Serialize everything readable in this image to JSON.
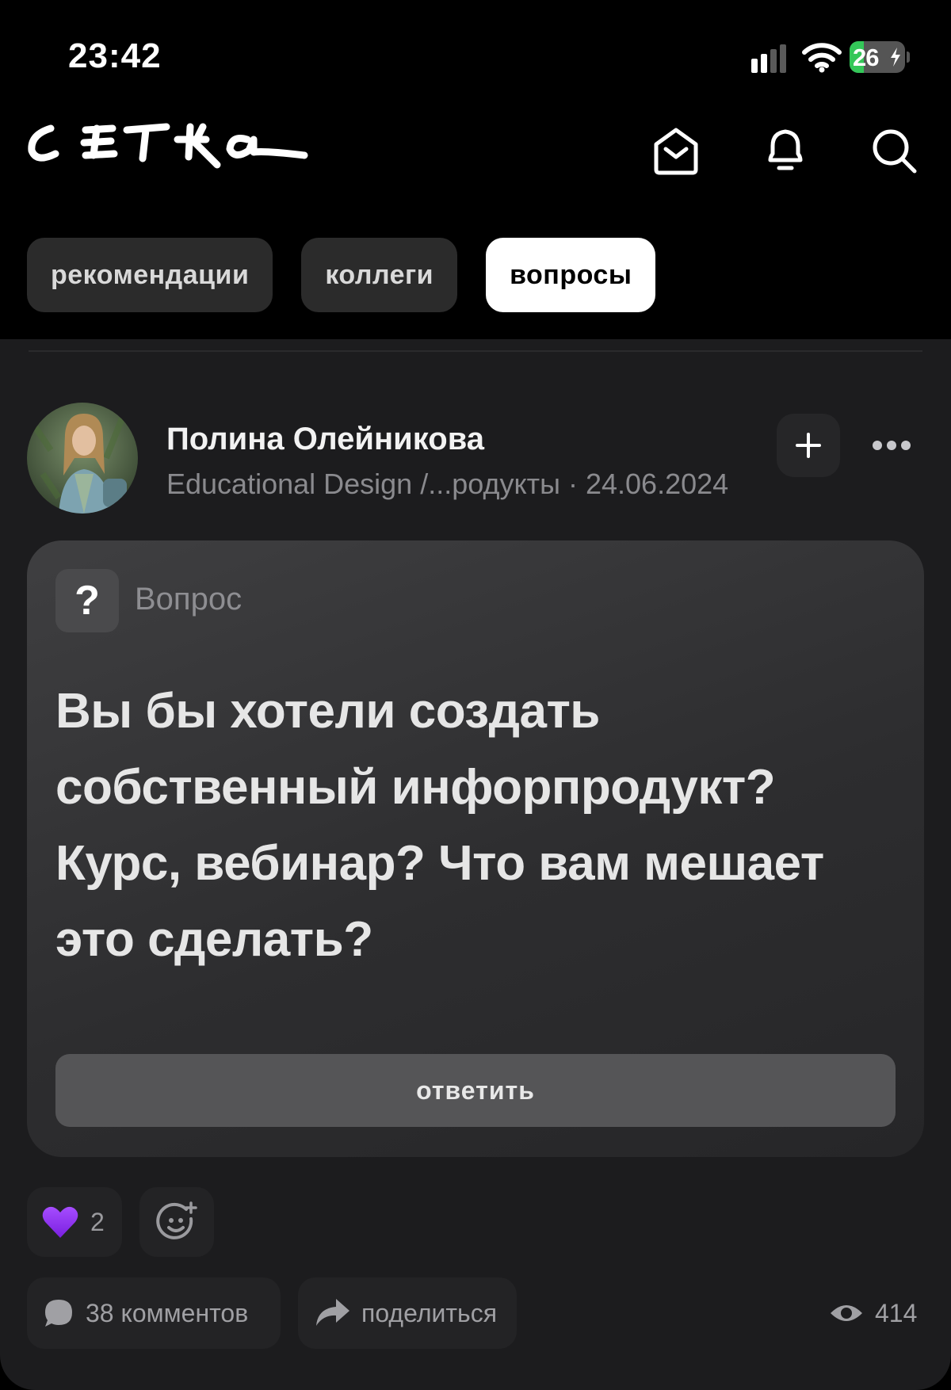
{
  "status_bar": {
    "time": "23:42",
    "battery_level": "26",
    "battery_fraction": 0.26,
    "icons": [
      "signal-icon",
      "wifi-icon",
      "battery-icon"
    ]
  },
  "header": {
    "logo_text": "сетка",
    "icons": [
      "mail-icon",
      "bell-icon",
      "search-icon"
    ]
  },
  "tabs": [
    {
      "label": "рекомендации",
      "active": false
    },
    {
      "label": "коллеги",
      "active": false
    },
    {
      "label": "вопросы",
      "active": true
    }
  ],
  "post": {
    "author": "Полина Олейникова",
    "meta": "Educational Design /...родукты · 24.06.2024",
    "type_badge": "?",
    "type_label": "Вопрос",
    "question": "Вы бы хотели создать собственный инфорпродукт? Курс, вебинар? Что вам мешает это сделать?",
    "answer_label": "ответить",
    "reactions": {
      "emoji": "purple-heart",
      "count": "2"
    },
    "comments_label": "38 комментов",
    "share_label": "поделиться",
    "views": "414"
  },
  "colors": {
    "background": "#000000",
    "feed": "#1c1c1e",
    "active_tab": "#ffffff",
    "battery_green": "#34c759",
    "heart": "#8b2cf5"
  }
}
